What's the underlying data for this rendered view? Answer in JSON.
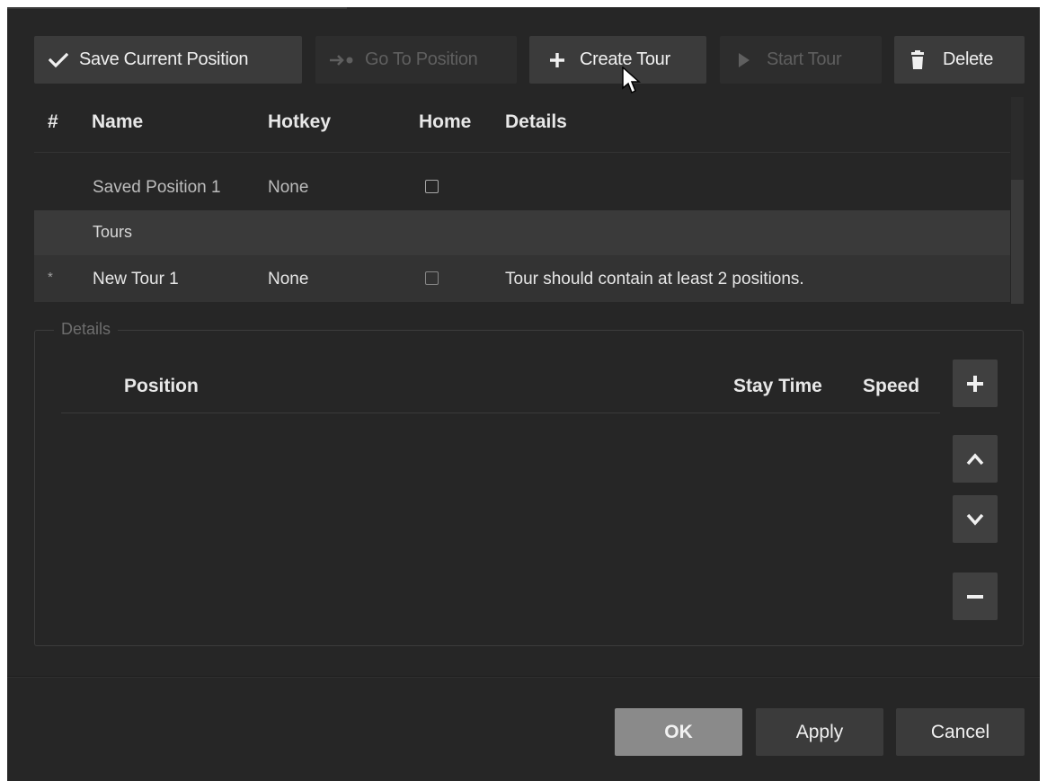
{
  "toolbar": {
    "save_label": "Save Current Position",
    "goto_label": "Go To Position",
    "create_tour_label": "Create Tour",
    "start_tour_label": "Start Tour",
    "delete_label": "Delete"
  },
  "table": {
    "columns": [
      "#",
      "Name",
      "Hotkey",
      "Home",
      "Details"
    ],
    "rows": [
      {
        "marker": "",
        "name": "Saved Position 1",
        "hotkey": "None",
        "home": false,
        "details": ""
      },
      {
        "section": "Tours"
      },
      {
        "marker": "*",
        "name": "New Tour 1",
        "hotkey": "None",
        "home": false,
        "details": "Tour should contain at least 2 positions."
      }
    ]
  },
  "details": {
    "title": "Details",
    "columns": [
      "Position",
      "Stay Time",
      "Speed"
    ]
  },
  "footer": {
    "ok_label": "OK",
    "apply_label": "Apply",
    "cancel_label": "Cancel"
  },
  "colors": {
    "background": "#262626",
    "button": "#3b3b3b",
    "selected_row": "#3a3a3a",
    "primary_button": "#8a8a8a"
  }
}
